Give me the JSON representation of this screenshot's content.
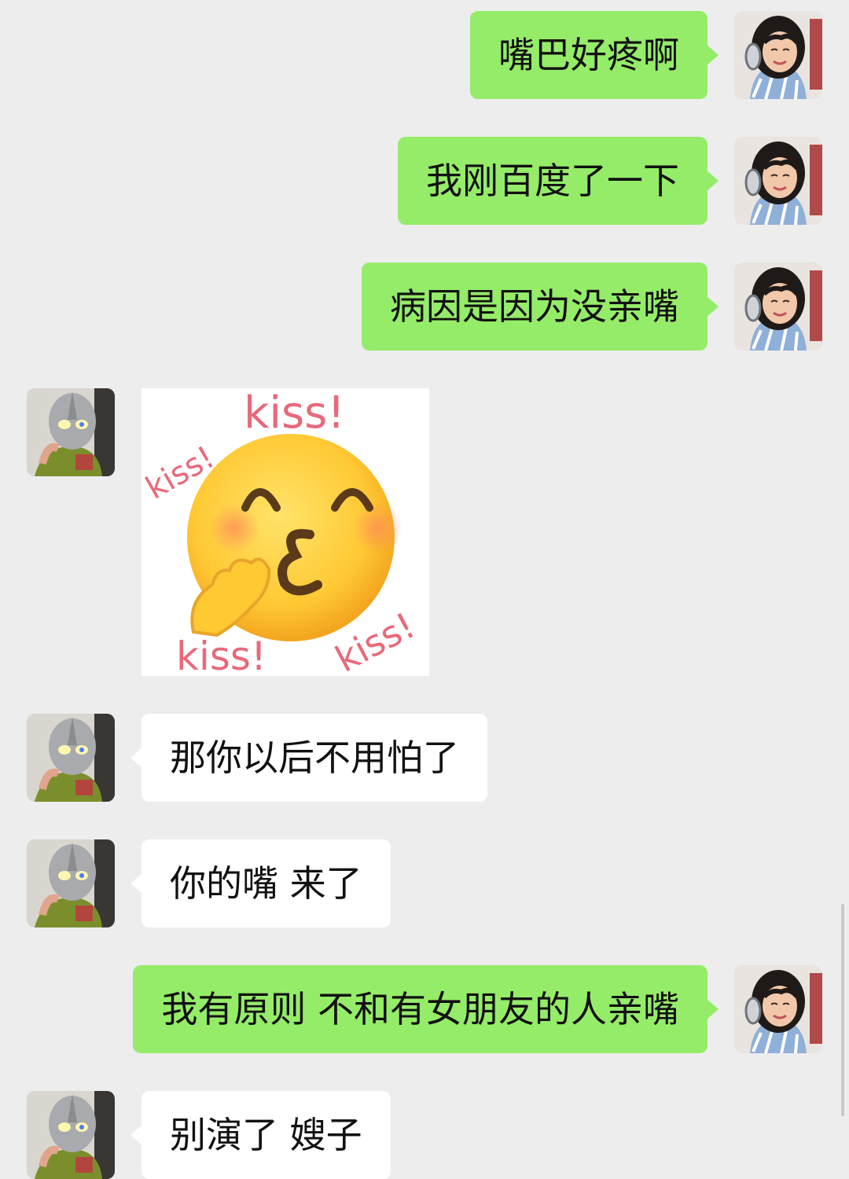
{
  "messages": [
    {
      "side": "me",
      "text": "嘴巴好疼啊"
    },
    {
      "side": "me",
      "text": "我刚百度了一下"
    },
    {
      "side": "me",
      "text": "病因是因为没亲嘴"
    },
    {
      "side": "them",
      "type": "sticker",
      "sticker_words": [
        "kiss!",
        "kiss!",
        "kiss!",
        "kiss!"
      ]
    },
    {
      "side": "them",
      "text": "那你以后不用怕了"
    },
    {
      "side": "them",
      "text": "你的嘴 来了"
    },
    {
      "side": "me",
      "text": "我有原则 不和有女朋友的人亲嘴"
    },
    {
      "side": "them",
      "text": "别演了 嫂子"
    }
  ],
  "colors": {
    "background": "#ededed",
    "my_bubble": "#95ec69",
    "their_bubble": "#ffffff",
    "sticker_text": "#e8697a"
  },
  "icons": {
    "my_avatar": "girl-with-headphones-avatar",
    "their_avatar": "ultraman-avatar",
    "sticker": "kissing-face-emoji-sticker"
  }
}
